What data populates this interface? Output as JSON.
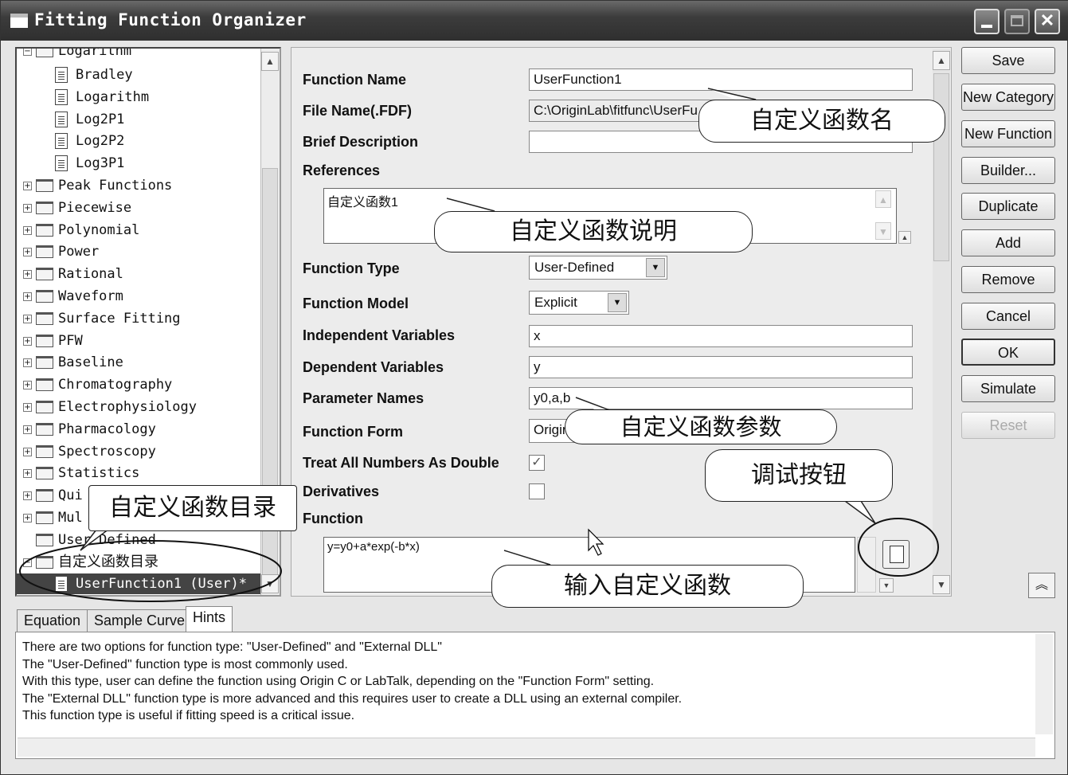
{
  "window": {
    "title": "Fitting Function Organizer"
  },
  "tree": {
    "items": [
      {
        "label": "Logarithm",
        "type": "folder"
      },
      {
        "label": "Bradley",
        "type": "file"
      },
      {
        "label": "Logarithm",
        "type": "file"
      },
      {
        "label": "Log2P1",
        "type": "file"
      },
      {
        "label": "Log2P2",
        "type": "file"
      },
      {
        "label": "Log3P1",
        "type": "file"
      },
      {
        "label": "Peak Functions",
        "type": "folder"
      },
      {
        "label": "Piecewise",
        "type": "folder"
      },
      {
        "label": "Polynomial",
        "type": "folder"
      },
      {
        "label": "Power",
        "type": "folder"
      },
      {
        "label": "Rational",
        "type": "folder"
      },
      {
        "label": "Waveform",
        "type": "folder"
      },
      {
        "label": "Surface Fitting",
        "type": "folder"
      },
      {
        "label": "PFW",
        "type": "folder"
      },
      {
        "label": "Baseline",
        "type": "folder"
      },
      {
        "label": "Chromatography",
        "type": "folder"
      },
      {
        "label": "Electrophysiology",
        "type": "folder"
      },
      {
        "label": "Pharmacology",
        "type": "folder"
      },
      {
        "label": "Spectroscopy",
        "type": "folder"
      },
      {
        "label": "Statistics",
        "type": "folder"
      },
      {
        "label": "Qui",
        "type": "folder"
      },
      {
        "label": "Mul",
        "type": "folder"
      },
      {
        "label": "User Defined",
        "type": "folder"
      },
      {
        "label": "自定义函数目录",
        "type": "folder"
      },
      {
        "label": "UserFunction1 (User)*",
        "type": "file"
      }
    ]
  },
  "form": {
    "function_name": {
      "label": "Function Name",
      "value": "UserFunction1"
    },
    "file_name": {
      "label": "File Name(.FDF)",
      "value": "C:\\OriginLab\\fitfunc\\UserFu"
    },
    "brief_description": {
      "label": "Brief Description",
      "value": ""
    },
    "references": {
      "label": "References",
      "value": "自定义函数1"
    },
    "function_type": {
      "label": "Function Type",
      "value": "User-Defined"
    },
    "function_model": {
      "label": "Function Model",
      "value": "Explicit"
    },
    "independent_variables": {
      "label": "Independent Variables",
      "value": "x"
    },
    "dependent_variables": {
      "label": "Dependent Variables",
      "value": "y"
    },
    "parameter_names": {
      "label": "Parameter Names",
      "value": "y0,a,b"
    },
    "function_form": {
      "label": "Function Form",
      "value": "Origin"
    },
    "treat_all_numbers_as_double": {
      "label": "Treat All Numbers As Double",
      "checked": true
    },
    "derivatives": {
      "label": "Derivatives",
      "checked": false
    },
    "function": {
      "label": "Function",
      "value": "y=y0+a*exp(-b*x)"
    }
  },
  "buttons": {
    "save": "Save",
    "new_category": "New Category",
    "new_function": "New Function",
    "builder": "Builder...",
    "duplicate": "Duplicate",
    "add": "Add",
    "remove": "Remove",
    "cancel": "Cancel",
    "ok": "OK",
    "simulate": "Simulate",
    "reset": "Reset"
  },
  "tabs": [
    "Equation",
    "Sample Curve",
    "Hints"
  ],
  "active_tab": "Hints",
  "hints": [
    "There are two options for function type: \"User-Defined\" and \"External DLL\"",
    "The \"User-Defined\" function type is most commonly used.",
    "With this type, user can define the function using Origin C or LabTalk, depending on the \"Function Form\" setting.",
    "The \"External DLL\" function type is more advanced and this requires user to create a DLL using an external compiler.",
    "This function type is useful if fitting speed is a critical issue."
  ],
  "annotations": {
    "function_name": "自定义函数名",
    "description": "自定义函数说明",
    "parameters": "自定义函数参数",
    "debug_button": "调试按钮",
    "category": "自定义函数目录",
    "input_function": "输入自定义函数"
  }
}
